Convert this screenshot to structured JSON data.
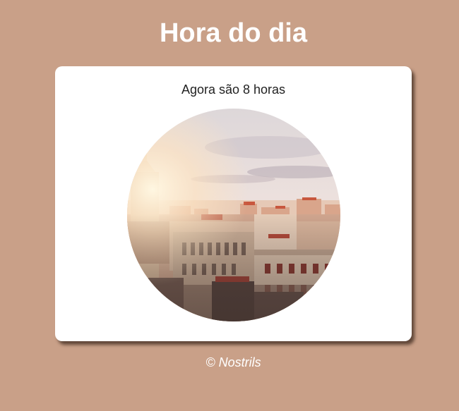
{
  "header": {
    "title": "Hora do dia"
  },
  "card": {
    "status_text": "Agora são 8 horas",
    "image": {
      "shape": "circle",
      "subject": "city-skyline-at-sunrise"
    }
  },
  "footer": {
    "copyright": "© Nostrils"
  },
  "colors": {
    "background": "#c9a088",
    "card": "#ffffff",
    "title_text": "#ffffff",
    "body_text": "#222222"
  }
}
